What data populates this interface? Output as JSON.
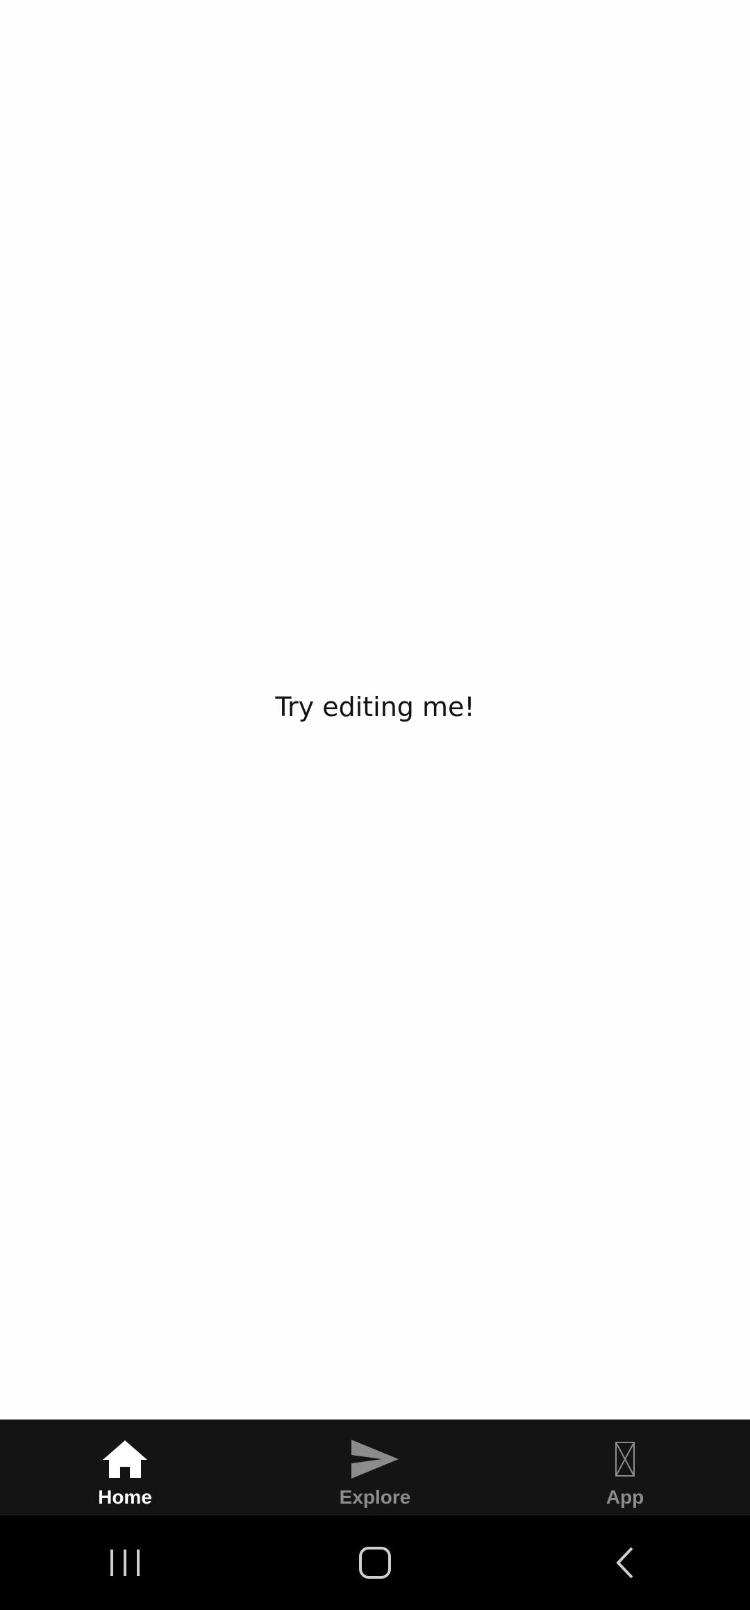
{
  "main": {
    "message": "Try editing me!"
  },
  "bottom_nav": {
    "items": [
      {
        "label": "Home",
        "icon": "home-icon",
        "active": true
      },
      {
        "label": "Explore",
        "icon": "send-icon",
        "active": false
      },
      {
        "label": "App",
        "icon": "placeholder-icon",
        "active": false
      }
    ]
  },
  "system_nav": {
    "buttons": [
      "recents-icon",
      "home-circle-icon",
      "back-icon"
    ]
  },
  "colors": {
    "background": "#fefefe",
    "nav_bar": "#141414",
    "system_bar": "#000000",
    "active": "#ffffff",
    "inactive": "#8c8c8c"
  }
}
